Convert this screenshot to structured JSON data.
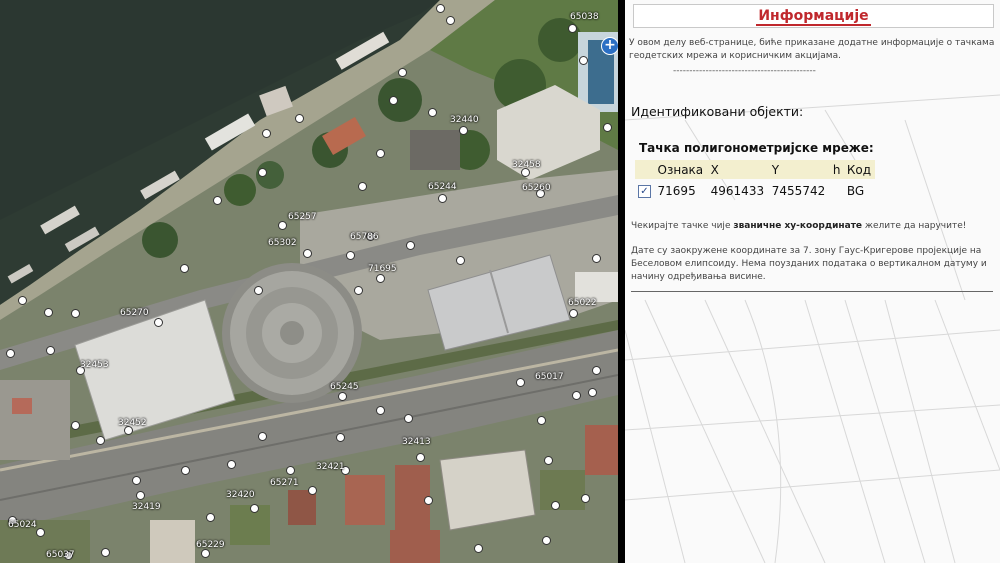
{
  "info_panel": {
    "title": "Информације",
    "intro": "У овом делу веб-странице, биће приказане додатне информације о тачкама геодетских мрежа и корисничким акцијама.",
    "dash": "--------------------------------------------",
    "identified_label": "Идентификовани објекти:",
    "network_title": "Тачка полигонометријске мреже:",
    "table": {
      "headers": [
        "",
        "Ознака",
        "X",
        "Y",
        "h",
        "Код"
      ],
      "rows": [
        {
          "checked": true,
          "oznaka": "71695",
          "x": "4961433",
          "y": "7455742",
          "h": "",
          "kod": "BG"
        }
      ]
    },
    "hint_before": "Чекирајте тачке чије ",
    "hint_bold": "званичне xy-координате",
    "hint_after": " желите да наручите!",
    "note": "Дате су заокружене координате за 7. зону Гаус-Кригерове пројекције на Беселовом елипсоиду. Нема поузданих података о вертикалном датуму и начину одређивања висине."
  },
  "map": {
    "zoom_symbol": "+",
    "point_labels": [
      "32458",
      "65244",
      "65260",
      "65257",
      "65302",
      "65786",
      "71695",
      "65270",
      "65245",
      "32452",
      "32453",
      "32420",
      "32413",
      "32421",
      "65037",
      "65271",
      "65229",
      "32419",
      "65024",
      "65022",
      "32440",
      "65038",
      "65017"
    ],
    "colors": {
      "water": "#2e3b33",
      "grass": "#5f7a45",
      "roof": "#d9d9d6",
      "road": "#8a8a86",
      "dome": "#9c9c96"
    }
  }
}
